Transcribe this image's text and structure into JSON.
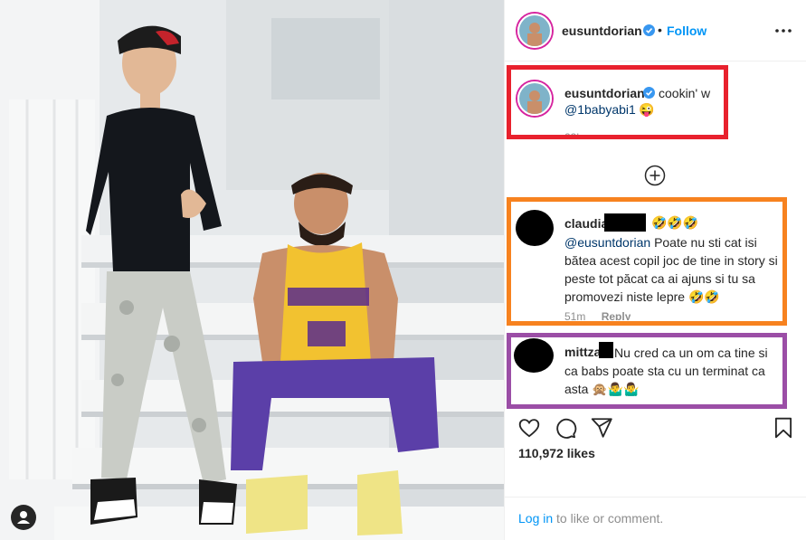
{
  "post": {
    "username": "eusuntdorian",
    "follow_label": "Follow",
    "separator": "•",
    "caption_text": "cookin' w",
    "caption_mention": "@1babyabi1",
    "caption_emoji": "😜",
    "caption_time": "23h",
    "likes": "110,972 likes"
  },
  "comments": [
    {
      "username": "claudia",
      "emoji": "🤣🤣🤣",
      "mention": "@eusuntdorian",
      "text": "Poate nu sti cat isi bătea acest copil joc de tine in story si peste tot păcat ca ai ajuns si tu sa promovezi niste lepre 🤣🤣",
      "time": "51m",
      "reply_label": "Reply"
    },
    {
      "username": "mittza",
      "text": "Nu cred ca un om ca tine si ca babs poate sta cu un terminat ca asta 🙊🤷‍♂️🤷‍♂️"
    }
  ],
  "footer": {
    "login_link": "Log in",
    "login_text": " to like or comment."
  },
  "annotations": {
    "red": "#e8212d",
    "orange": "#f7821f",
    "purple": "#9b4ea6"
  },
  "icons": [
    "more-options-icon",
    "verified-icon",
    "load-more-comments-icon",
    "heart-icon",
    "comment-icon",
    "share-icon",
    "save-icon",
    "user-tag-icon"
  ]
}
